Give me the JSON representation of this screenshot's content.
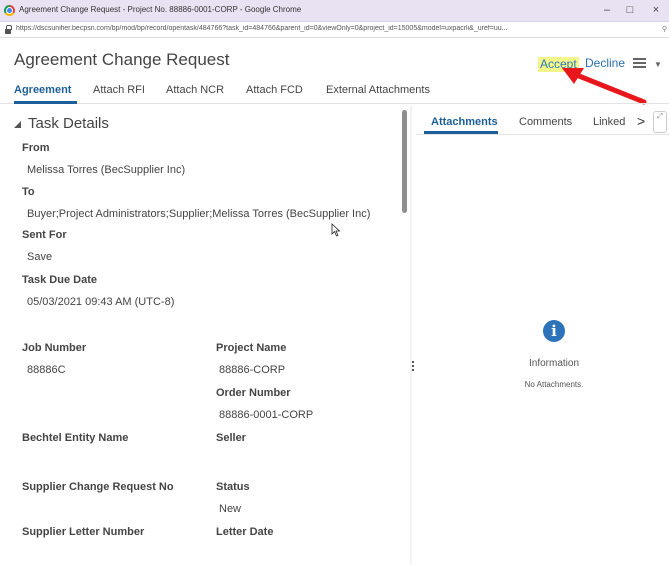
{
  "window": {
    "title": "Agreement Change Request - Project No. 88886-0001-CORP - Google Chrome",
    "url": "https://dscsunifier.becpsn.com/bp/mod/bp/record/opentask/484766?task_id=484766&parent_id=0&viewOnly=0&project_id=15005&model=uxpacrli&_uref=uu...",
    "controls": {
      "minimize": "–",
      "maximize": "□",
      "close": "×"
    }
  },
  "header": {
    "title": "Agreement Change Request",
    "accept_label": "Accept",
    "decline_label": "Decline"
  },
  "tabs": [
    {
      "label": "Agreement"
    },
    {
      "label": "Attach RFI"
    },
    {
      "label": "Attach NCR"
    },
    {
      "label": "Attach FCD"
    },
    {
      "label": "External Attachments"
    }
  ],
  "task_details": {
    "section_title": "Task Details",
    "from_label": "From",
    "from_value": "Melissa Torres (BecSupplier Inc)",
    "to_label": "To",
    "to_value": "Buyer;Project Administrators;Supplier;Melissa Torres (BecSupplier Inc)",
    "sent_for_label": "Sent For",
    "sent_for_value": "Save",
    "due_label": "Task Due Date",
    "due_value": "05/03/2021 09:43 AM (UTC-8)"
  },
  "fields": {
    "job_number_label": "Job Number",
    "job_number_value": "88886C",
    "project_name_label": "Project Name",
    "project_name_value": "88886-CORP",
    "order_number_label": "Order Number",
    "order_number_value": "88886-0001-CORP",
    "entity_label": "Bechtel Entity Name",
    "seller_label": "Seller",
    "supplier_cr_label": "Supplier Change Request No",
    "status_label": "Status",
    "status_value": "New",
    "supplier_letter_label": "Supplier Letter Number",
    "letter_date_label": "Letter Date"
  },
  "right_panel": {
    "tabs": [
      {
        "label": "Attachments"
      },
      {
        "label": "Comments"
      },
      {
        "label": "Linked"
      }
    ],
    "next_label": ">",
    "info_icon_glyph": "i",
    "info_title": "Information",
    "info_message": "No Attachments."
  },
  "colors": {
    "accent": "#1d5f9a",
    "accept_highlight": "#f4f58a",
    "annotation_arrow": "#e8171b",
    "info_icon": "#2c73b9"
  }
}
